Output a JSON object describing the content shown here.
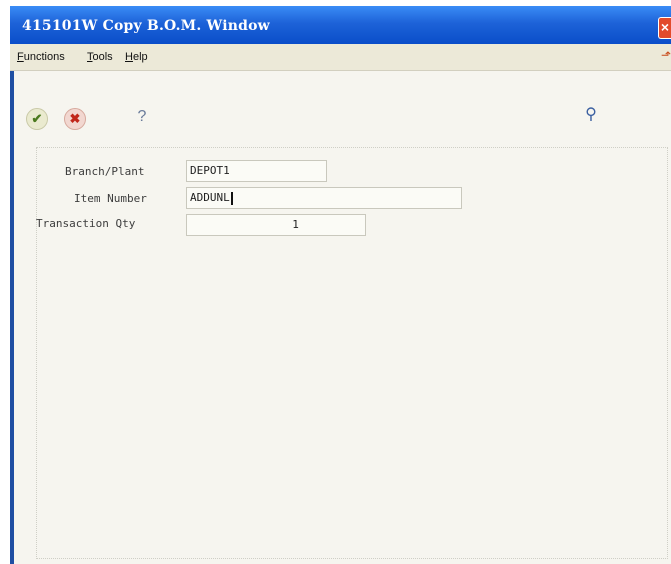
{
  "window": {
    "title": "415101W   Copy B.O.M. Window"
  },
  "menu": {
    "items": [
      "Functions",
      "Tools",
      "Help"
    ]
  },
  "toolbar": {
    "ok_icon": "✔",
    "cancel_icon": "✖",
    "help_icon": "?",
    "find_icon": "⚲"
  },
  "form": {
    "branch_plant": {
      "label": "Branch/Plant",
      "value": "DEPOT1"
    },
    "item_number": {
      "label": "Item Number",
      "value": "ADDUNL"
    },
    "transaction_qty": {
      "label": "Transaction Qty",
      "value": "1"
    }
  }
}
